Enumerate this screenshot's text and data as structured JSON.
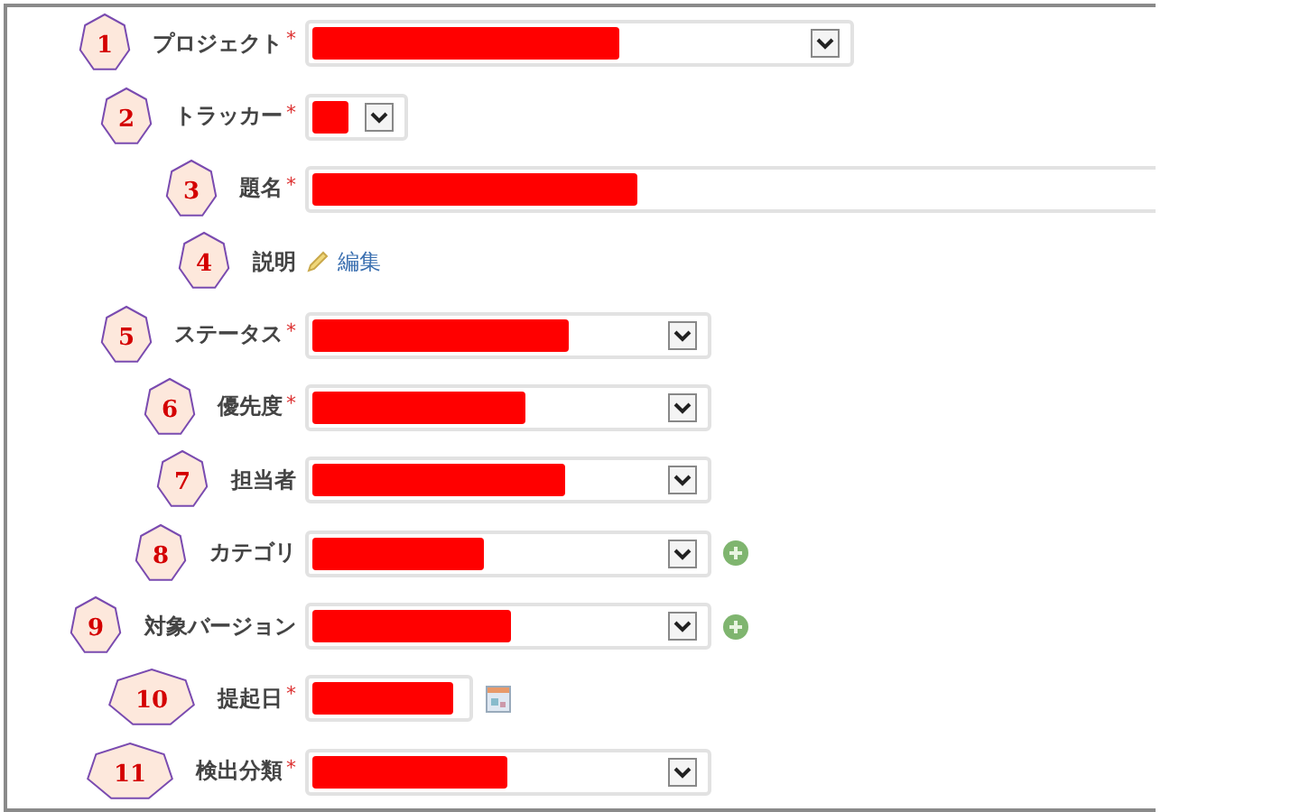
{
  "fields": [
    {
      "badge": "1",
      "label": "プロジェクト",
      "required_mark": "*",
      "kind": "select",
      "redacted": true
    },
    {
      "badge": "2",
      "label": "トラッカー",
      "required_mark": "*",
      "kind": "select",
      "redacted": true
    },
    {
      "badge": "3",
      "label": "題名",
      "required_mark": "*",
      "kind": "text",
      "redacted": true
    },
    {
      "badge": "4",
      "label": "説明",
      "kind": "description",
      "link": "編集"
    },
    {
      "badge": "5",
      "label": "ステータス",
      "required_mark": "*",
      "kind": "select",
      "redacted": true
    },
    {
      "badge": "6",
      "label": "優先度",
      "required_mark": "*",
      "kind": "select",
      "redacted": true
    },
    {
      "badge": "7",
      "label": "担当者",
      "kind": "select",
      "redacted": true
    },
    {
      "badge": "8",
      "label": "カテゴリ",
      "kind": "select",
      "redacted": true,
      "add_button": true
    },
    {
      "badge": "9",
      "label": "対象バージョン",
      "kind": "select",
      "redacted": true,
      "add_button": true
    },
    {
      "badge": "10",
      "label": "提起日",
      "required_mark": "*",
      "kind": "date",
      "redacted": true
    },
    {
      "badge": "11",
      "label": "検出分類",
      "required_mark": "*",
      "kind": "select",
      "redacted": true
    }
  ]
}
